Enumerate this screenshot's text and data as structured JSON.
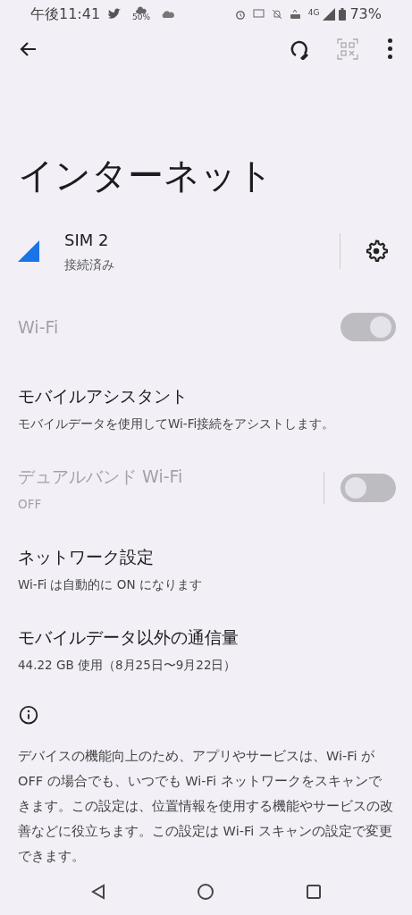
{
  "status_bar": {
    "time": "午後11:41",
    "weather_percent": "50%",
    "network": "4G",
    "battery": "73%"
  },
  "title": "インターネット",
  "sim": {
    "name": "SIM 2",
    "status": "接続済み"
  },
  "settings": [
    {
      "kind": "toggle",
      "title": "Wi-Fi",
      "on": true,
      "disabled": true,
      "divider": false
    },
    {
      "kind": "text",
      "title": "モバイルアシスタント",
      "summary": "モバイルデータを使用してWi-Fi接続をアシストします。"
    },
    {
      "kind": "toggle",
      "title": "デュアルバンド Wi-Fi",
      "summary": "OFF",
      "on": false,
      "disabled": true,
      "divider": true
    },
    {
      "kind": "text",
      "title": "ネットワーク設定",
      "summary": "Wi-Fi は自動的に ON になります"
    },
    {
      "kind": "text",
      "title": "モバイルデータ以外の通信量",
      "summary": "44.22 GB 使用（8月25日〜9月22日）"
    }
  ],
  "info": "デバイスの機能向上のため、アプリやサービスは、Wi-Fi が OFF の場合でも、いつでも Wi-Fi ネットワークをスキャンできます。この設定は、位置情報を使用する機能やサービスの改善などに役立ちます。この設定は Wi-Fi スキャンの設定で変更できます。"
}
